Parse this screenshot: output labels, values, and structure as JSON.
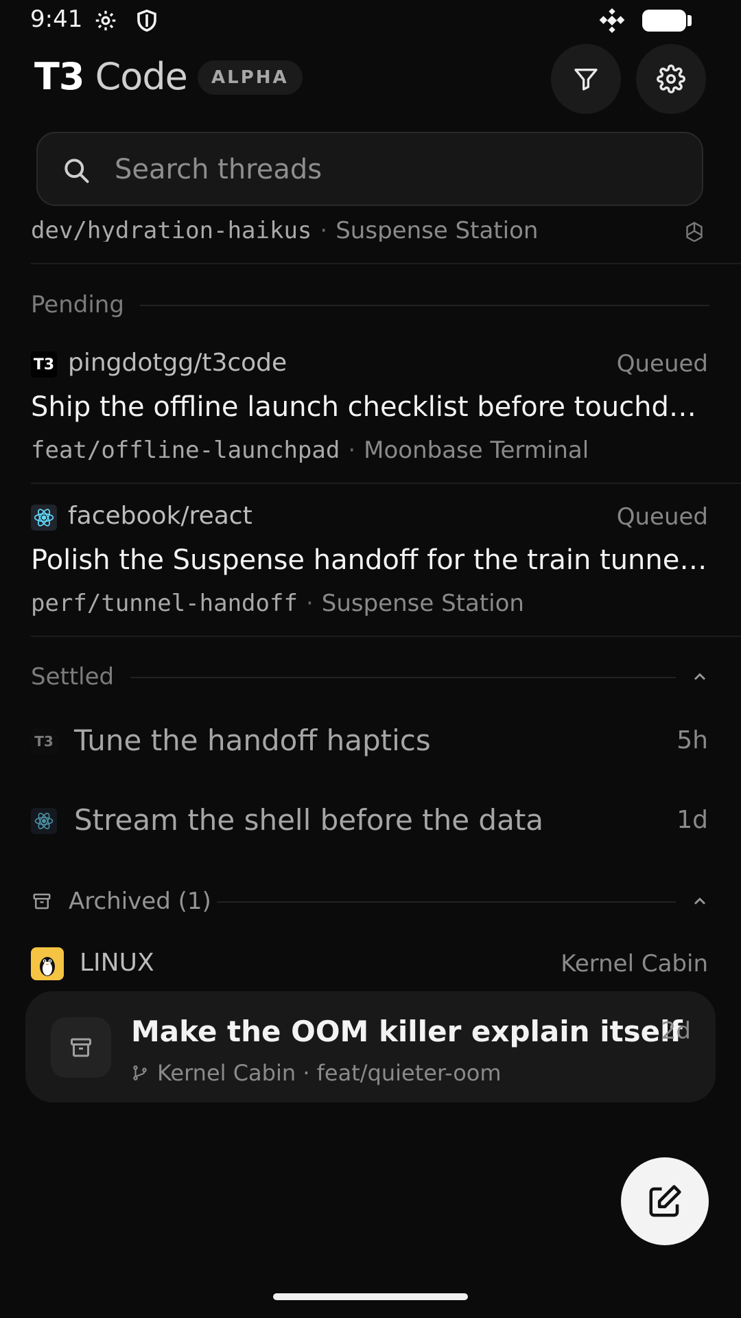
{
  "status_bar": {
    "time": "9:41"
  },
  "header": {
    "brand_primary": "T3",
    "brand_secondary": "Code",
    "badge": "ALPHA"
  },
  "search": {
    "placeholder": "Search threads",
    "value": ""
  },
  "partial_row": {
    "branch": "dev/hydration-haikus",
    "location": "Suspense Station"
  },
  "sections": {
    "pending": {
      "label": "Pending",
      "threads": [
        {
          "repo": "pingdotgg/t3code",
          "status": "Queued",
          "title": "Ship the offline launch checklist before touchdown",
          "branch": "feat/offline-launchpad",
          "location": "Moonbase Terminal"
        },
        {
          "repo": "facebook/react",
          "status": "Queued",
          "title": "Polish the Suspense handoff for the train tunnel transition",
          "branch": "perf/tunnel-handoff",
          "location": "Suspense Station"
        }
      ]
    },
    "settled": {
      "label": "Settled",
      "threads": [
        {
          "title": "Tune the handoff haptics",
          "age": "5h"
        },
        {
          "title": "Stream the shell before the data",
          "age": "1d"
        }
      ]
    },
    "archived": {
      "label": "Archived (1)",
      "group": {
        "repo": "LINUX",
        "location": "Kernel Cabin"
      },
      "card": {
        "title": "Make the OOM killer explain itself",
        "age": "2d",
        "meta": "Kernel Cabin · feat/quieter-oom"
      }
    }
  },
  "meta_separator": "·",
  "icons": {
    "t3_logo": "T3",
    "react_color": "#61dafb",
    "linux_bg": "#f5c443"
  }
}
